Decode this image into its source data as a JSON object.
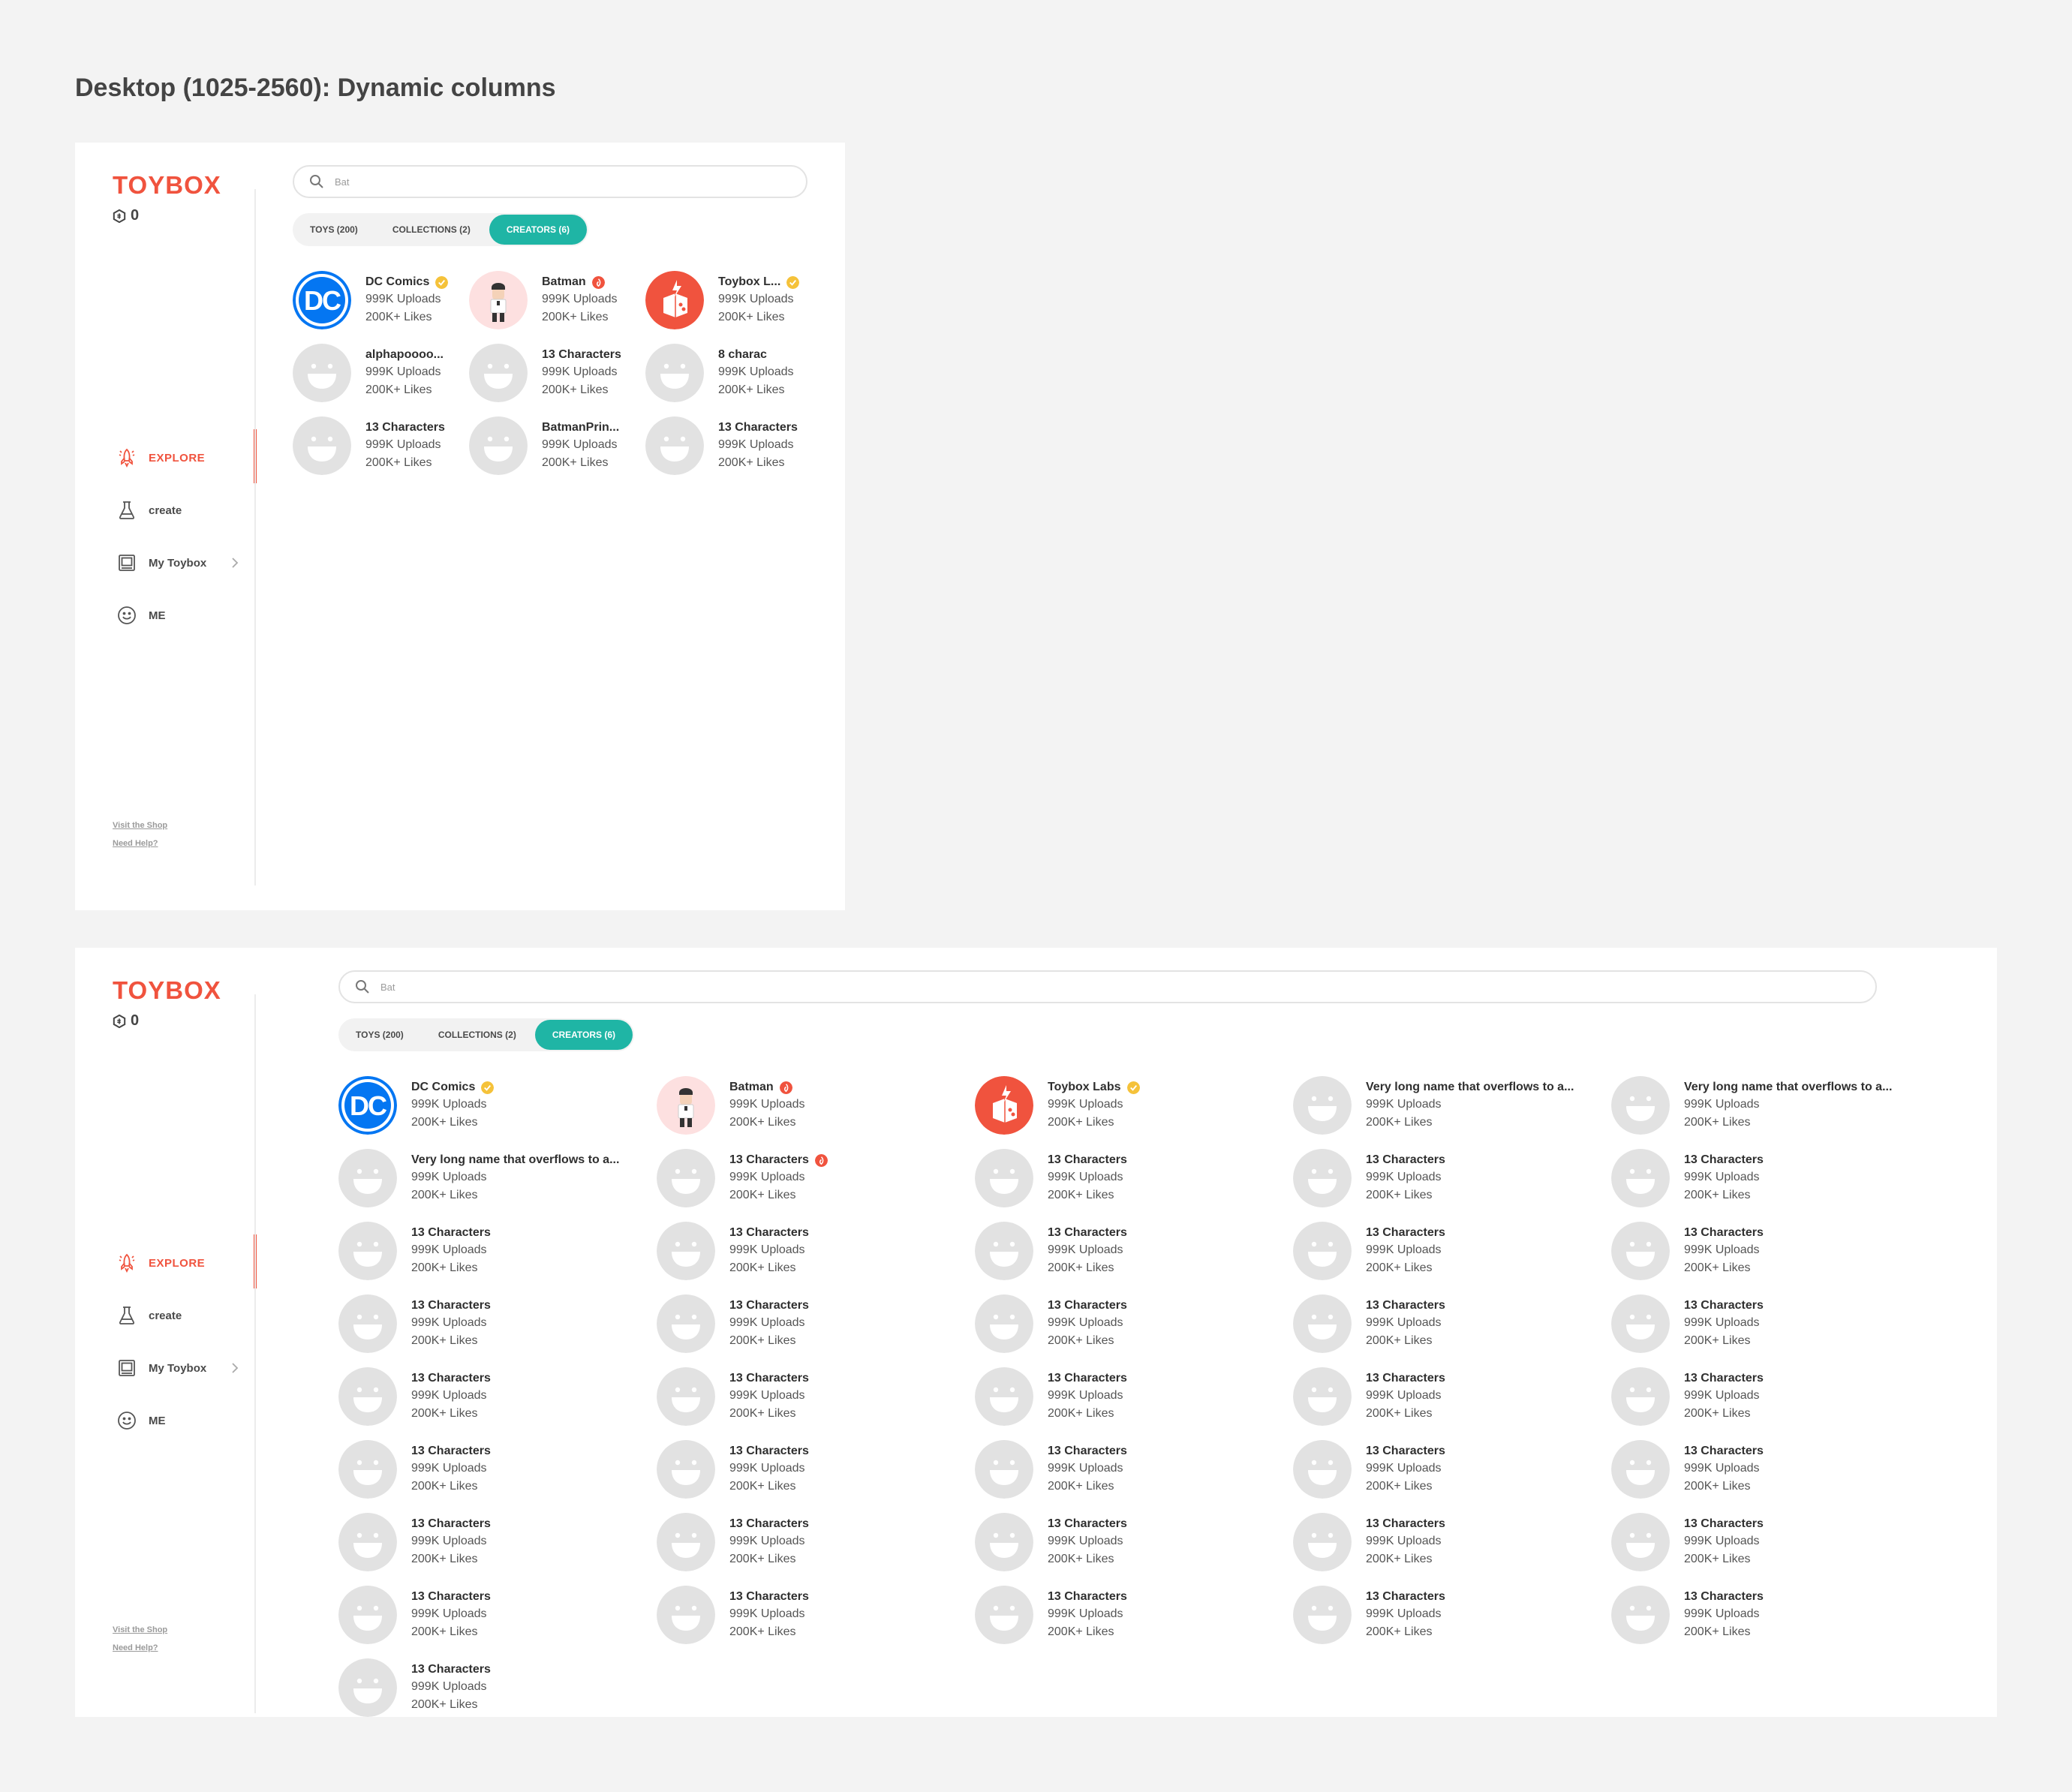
{
  "page_heading": "Desktop (1025-2560): Dynamic columns",
  "colors": {
    "brand": "#f0533e",
    "accent": "#1fb5a5",
    "verified": "#f5c23a",
    "hot": "#f0533e"
  },
  "app": {
    "logo": "TOYBOX",
    "coins": "0",
    "nav": [
      {
        "label": "EXPLORE",
        "icon": "rocket-icon",
        "active": true
      },
      {
        "label": "create",
        "icon": "flask-icon"
      },
      {
        "label": "My Toybox",
        "icon": "box-icon",
        "chevron": true
      },
      {
        "label": "ME",
        "icon": "smiley-icon"
      }
    ],
    "footer": {
      "shop": "Visit the Shop",
      "help": "Need Help?"
    },
    "search": {
      "value": "Bat"
    },
    "tabs": [
      {
        "label": "TOYS (200)"
      },
      {
        "label": "COLLECTIONS (2)"
      },
      {
        "label": "CREATORS (6)",
        "active": true
      }
    ]
  },
  "frame1": {
    "creators": [
      {
        "name": "DC Comics",
        "uploads": "999K Uploads",
        "likes": "200K+ Likes",
        "avatar": "dc-logo",
        "badge": "verified"
      },
      {
        "name": "Batman",
        "uploads": "999K Uploads",
        "likes": "200K+ Likes",
        "avatar": "person",
        "badge": "hot"
      },
      {
        "name": "Toybox L...",
        "uploads": "999K Uploads",
        "likes": "200K+ Likes",
        "avatar": "toybox-labs",
        "badge": "verified"
      },
      {
        "name": "alphapoooo...",
        "uploads": "999K Uploads",
        "likes": "200K+ Likes",
        "avatar": "placeholder"
      },
      {
        "name": "13 Characters",
        "uploads": "999K Uploads",
        "likes": "200K+ Likes",
        "avatar": "placeholder"
      },
      {
        "name": "8 charac",
        "uploads": "999K Uploads",
        "likes": "200K+ Likes",
        "avatar": "placeholder"
      },
      {
        "name": "13 Characters",
        "uploads": "999K Uploads",
        "likes": "200K+ Likes",
        "avatar": "placeholder"
      },
      {
        "name": "BatmanPrin...",
        "uploads": "999K Uploads",
        "likes": "200K+ Likes",
        "avatar": "placeholder"
      },
      {
        "name": "13 Characters",
        "uploads": "999K Uploads",
        "likes": "200K+ Likes",
        "avatar": "placeholder"
      }
    ]
  },
  "frame2": {
    "creators": [
      {
        "name": "DC Comics",
        "uploads": "999K Uploads",
        "likes": "200K+ Likes",
        "avatar": "dc-logo",
        "badge": "verified"
      },
      {
        "name": "Batman",
        "uploads": "999K Uploads",
        "likes": "200K+ Likes",
        "avatar": "person",
        "badge": "hot"
      },
      {
        "name": "Toybox Labs",
        "uploads": "999K Uploads",
        "likes": "200K+ Likes",
        "avatar": "toybox-labs",
        "badge": "verified"
      },
      {
        "name": "Very long name that overflows to a...",
        "uploads": "999K Uploads",
        "likes": "200K+ Likes",
        "avatar": "placeholder"
      },
      {
        "name": "Very long name that overflows to a...",
        "uploads": "999K Uploads",
        "likes": "200K+ Likes",
        "avatar": "placeholder"
      },
      {
        "name": "Very long name that overflows to a...",
        "uploads": "999K Uploads",
        "likes": "200K+ Likes",
        "avatar": "placeholder"
      },
      {
        "name": "13 Characters",
        "uploads": "999K Uploads",
        "likes": "200K+ Likes",
        "avatar": "placeholder",
        "badge": "hot"
      },
      {
        "name": "13 Characters",
        "uploads": "999K Uploads",
        "likes": "200K+ Likes",
        "avatar": "placeholder"
      },
      {
        "name": "13 Characters",
        "uploads": "999K Uploads",
        "likes": "200K+ Likes",
        "avatar": "placeholder"
      },
      {
        "name": "13 Characters",
        "uploads": "999K Uploads",
        "likes": "200K+ Likes",
        "avatar": "placeholder"
      },
      {
        "name": "13 Characters",
        "uploads": "999K Uploads",
        "likes": "200K+ Likes",
        "avatar": "placeholder"
      },
      {
        "name": "13 Characters",
        "uploads": "999K Uploads",
        "likes": "200K+ Likes",
        "avatar": "placeholder"
      },
      {
        "name": "13 Characters",
        "uploads": "999K Uploads",
        "likes": "200K+ Likes",
        "avatar": "placeholder"
      },
      {
        "name": "13 Characters",
        "uploads": "999K Uploads",
        "likes": "200K+ Likes",
        "avatar": "placeholder"
      },
      {
        "name": "13 Characters",
        "uploads": "999K Uploads",
        "likes": "200K+ Likes",
        "avatar": "placeholder"
      },
      {
        "name": "13 Characters",
        "uploads": "999K Uploads",
        "likes": "200K+ Likes",
        "avatar": "placeholder"
      },
      {
        "name": "13 Characters",
        "uploads": "999K Uploads",
        "likes": "200K+ Likes",
        "avatar": "placeholder"
      },
      {
        "name": "13 Characters",
        "uploads": "999K Uploads",
        "likes": "200K+ Likes",
        "avatar": "placeholder"
      },
      {
        "name": "13 Characters",
        "uploads": "999K Uploads",
        "likes": "200K+ Likes",
        "avatar": "placeholder"
      },
      {
        "name": "13 Characters",
        "uploads": "999K Uploads",
        "likes": "200K+ Likes",
        "avatar": "placeholder"
      },
      {
        "name": "13 Characters",
        "uploads": "999K Uploads",
        "likes": "200K+ Likes",
        "avatar": "placeholder"
      },
      {
        "name": "13 Characters",
        "uploads": "999K Uploads",
        "likes": "200K+ Likes",
        "avatar": "placeholder"
      },
      {
        "name": "13 Characters",
        "uploads": "999K Uploads",
        "likes": "200K+ Likes",
        "avatar": "placeholder"
      },
      {
        "name": "13 Characters",
        "uploads": "999K Uploads",
        "likes": "200K+ Likes",
        "avatar": "placeholder"
      },
      {
        "name": "13 Characters",
        "uploads": "999K Uploads",
        "likes": "200K+ Likes",
        "avatar": "placeholder"
      },
      {
        "name": "13 Characters",
        "uploads": "999K Uploads",
        "likes": "200K+ Likes",
        "avatar": "placeholder"
      },
      {
        "name": "13 Characters",
        "uploads": "999K Uploads",
        "likes": "200K+ Likes",
        "avatar": "placeholder"
      },
      {
        "name": "13 Characters",
        "uploads": "999K Uploads",
        "likes": "200K+ Likes",
        "avatar": "placeholder"
      },
      {
        "name": "13 Characters",
        "uploads": "999K Uploads",
        "likes": "200K+ Likes",
        "avatar": "placeholder"
      },
      {
        "name": "13 Characters",
        "uploads": "999K Uploads",
        "likes": "200K+ Likes",
        "avatar": "placeholder"
      },
      {
        "name": "13 Characters",
        "uploads": "999K Uploads",
        "likes": "200K+ Likes",
        "avatar": "placeholder"
      },
      {
        "name": "13 Characters",
        "uploads": "999K Uploads",
        "likes": "200K+ Likes",
        "avatar": "placeholder"
      },
      {
        "name": "13 Characters",
        "uploads": "999K Uploads",
        "likes": "200K+ Likes",
        "avatar": "placeholder"
      },
      {
        "name": "13 Characters",
        "uploads": "999K Uploads",
        "likes": "200K+ Likes",
        "avatar": "placeholder"
      },
      {
        "name": "13 Characters",
        "uploads": "999K Uploads",
        "likes": "200K+ Likes",
        "avatar": "placeholder"
      },
      {
        "name": "13 Characters",
        "uploads": "999K Uploads",
        "likes": "200K+ Likes",
        "avatar": "placeholder"
      },
      {
        "name": "13 Characters",
        "uploads": "999K Uploads",
        "likes": "200K+ Likes",
        "avatar": "placeholder"
      },
      {
        "name": "13 Characters",
        "uploads": "999K Uploads",
        "likes": "200K+ Likes",
        "avatar": "placeholder"
      },
      {
        "name": "13 Characters",
        "uploads": "999K Uploads",
        "likes": "200K+ Likes",
        "avatar": "placeholder"
      },
      {
        "name": "13 Characters",
        "uploads": "999K Uploads",
        "likes": "200K+ Likes",
        "avatar": "placeholder"
      },
      {
        "name": "13 Characters",
        "uploads": "999K Uploads",
        "likes": "200K+ Likes",
        "avatar": "placeholder"
      }
    ]
  }
}
